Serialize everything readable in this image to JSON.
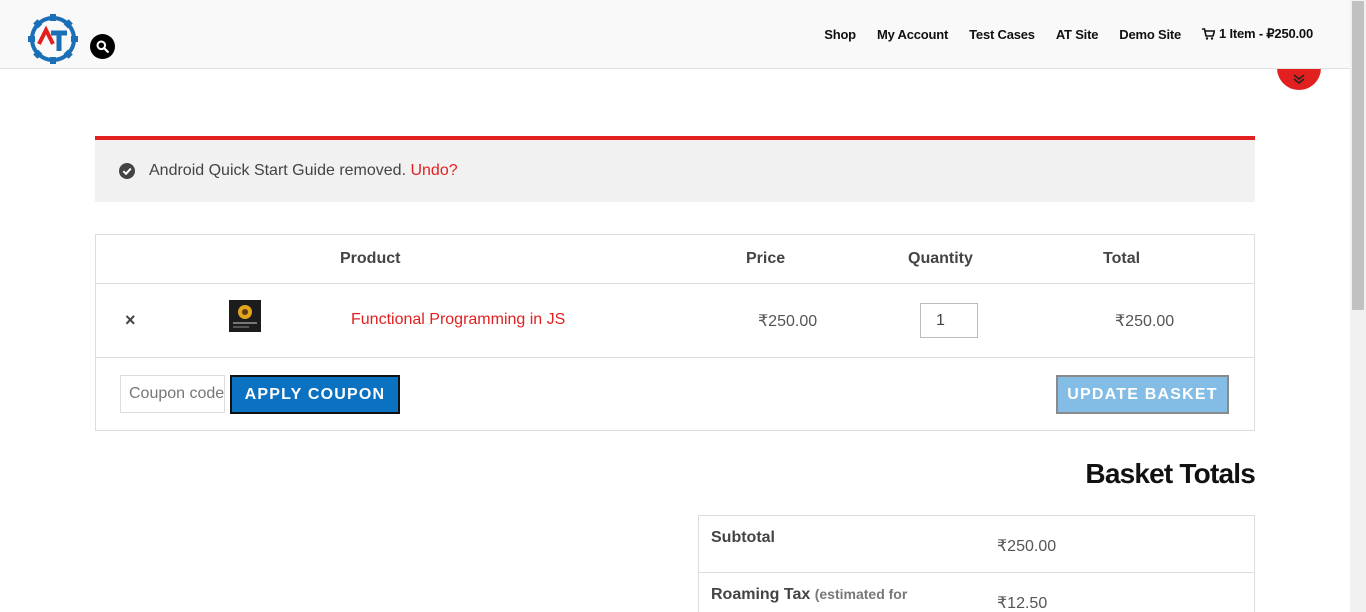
{
  "nav": {
    "items": [
      "Shop",
      "My Account",
      "Test Cases",
      "AT Site",
      "Demo Site"
    ],
    "cart_label": "1 Item - ₽250.00"
  },
  "notice": {
    "message": "Android Quick Start Guide removed.",
    "undo_label": "Undo?"
  },
  "cart": {
    "headers": {
      "product": "Product",
      "price": "Price",
      "quantity": "Quantity",
      "total": "Total"
    },
    "rows": [
      {
        "name": "Functional Programming in JS",
        "price": "₹250.00",
        "quantity": "1",
        "total": "₹250.00"
      }
    ],
    "remove_symbol": "×",
    "coupon_placeholder": "Coupon code",
    "apply_coupon_label": "APPLY COUPON",
    "update_basket_label": "UPDATE BASKET"
  },
  "totals": {
    "title": "Basket Totals",
    "subtotal_label": "Subtotal",
    "subtotal_value": "₹250.00",
    "tax_label": "Roaming Tax",
    "tax_note": "(estimated for",
    "tax_value": "₹12.50"
  },
  "colors": {
    "accent_red": "#e1201f",
    "apply_blue": "#0b72c1",
    "update_blue": "#83bde6",
    "logo_blue": "#1a6fb7"
  },
  "icons": {
    "search": "search-icon",
    "cart": "cart-icon",
    "check": "check-circle-icon",
    "scroll": "double-chevron-down-icon"
  }
}
